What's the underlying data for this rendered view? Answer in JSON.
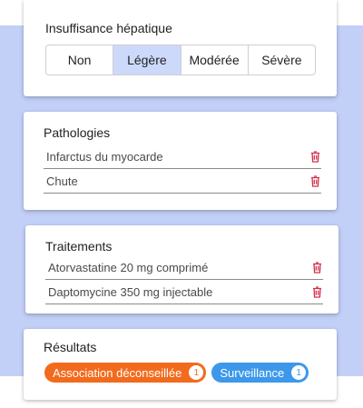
{
  "hepatic": {
    "title": "Insuffisance hépatique",
    "options": [
      "Non",
      "Légère",
      "Modérée",
      "Sévère"
    ],
    "selected": "Légère"
  },
  "pathologies": {
    "title": "Pathologies",
    "items": [
      "Infarctus du myocarde",
      "Chute"
    ]
  },
  "traitements": {
    "title": "Traitements",
    "items": [
      "Atorvastatine 20 mg comprimé",
      "Daptomycine 350 mg injectable"
    ]
  },
  "resultats": {
    "title": "Résultats",
    "chips": [
      {
        "label": "Association déconseillée",
        "count": "1",
        "color": "#f26b1d"
      },
      {
        "label": "Surveillance",
        "count": "1",
        "color": "#3d98ea"
      }
    ]
  },
  "colors": {
    "background": "#c2cff7",
    "selected_segment": "#cdd9fb",
    "delete_icon": "#d0304a"
  }
}
